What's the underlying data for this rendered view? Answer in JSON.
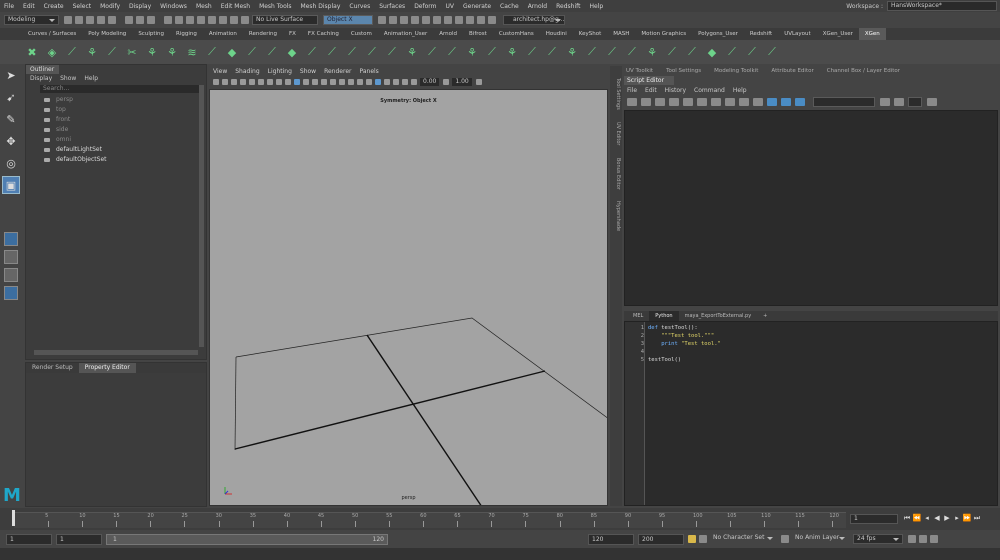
{
  "menubar": [
    "File",
    "Edit",
    "Create",
    "Select",
    "Modify",
    "Display",
    "Windows",
    "Mesh",
    "Edit Mesh",
    "Mesh Tools",
    "Mesh Display",
    "Curves",
    "Surfaces",
    "Deform",
    "UV",
    "Generate",
    "Cache",
    "Arnold",
    "Redshift",
    "Help"
  ],
  "workspace": {
    "label": "Workspace :",
    "value": "HansWorkspace*"
  },
  "statusline": {
    "mode": "Modeling",
    "live_surface": "No Live Surface",
    "symmetry": "Object X",
    "user": "architect.hp@g..."
  },
  "shelf_tabs": [
    "Curves / Surfaces",
    "Poly Modeling",
    "Sculpting",
    "Rigging",
    "Animation",
    "Rendering",
    "FX",
    "FX Caching",
    "Custom",
    "Animation_User",
    "Arnold",
    "Bifrost",
    "CustomHans",
    "Houdini",
    "KeyShot",
    "MASH",
    "Motion Graphics",
    "Polygons_User",
    "Redshift",
    "UVLayout",
    "XGen_User",
    "XGen"
  ],
  "shelf_active": "XGen",
  "outliner": {
    "title": "Outliner",
    "menu": [
      "Display",
      "Show",
      "Help"
    ],
    "search_placeholder": "Search...",
    "items": [
      {
        "label": "persp",
        "dim": true
      },
      {
        "label": "top",
        "dim": true
      },
      {
        "label": "front",
        "dim": true
      },
      {
        "label": "side",
        "dim": true
      },
      {
        "label": "omni",
        "dim": true
      },
      {
        "label": "defaultLightSet",
        "dim": false
      },
      {
        "label": "defaultObjectSet",
        "dim": false
      }
    ]
  },
  "lower_tabs": [
    "Render Setup",
    "Property Editor"
  ],
  "viewport": {
    "menu": [
      "View",
      "Shading",
      "Lighting",
      "Show",
      "Renderer",
      "Panels"
    ],
    "field1": "0.00",
    "field2": "1.00",
    "symmetry_label": "Symmetry: Object X",
    "camera": "persp"
  },
  "side_tabs": [
    "Tool Settings",
    "UV Editor",
    "Bonus Editor",
    "Hypershade"
  ],
  "right_tabs": [
    "UV Toolkit",
    "Tool Settings",
    "Modeling Toolkit",
    "Attribute Editor",
    "Channel Box / Layer Editor"
  ],
  "script_editor": {
    "title": "Script Editor",
    "menu": [
      "File",
      "Edit",
      "History",
      "Command",
      "Help"
    ],
    "tabs": [
      "MEL",
      "Python",
      "maya_ExportToExternal.py",
      "+"
    ],
    "active_tab": "Python",
    "lines": [
      {
        "n": "1",
        "code": "def testTool():"
      },
      {
        "n": "2",
        "code": "    \"\"\"Test tool.\"\"\""
      },
      {
        "n": "3",
        "code": "    print \"Test tool.\""
      },
      {
        "n": "4",
        "code": ""
      },
      {
        "n": "5",
        "code": "testTool()"
      }
    ]
  },
  "timeline": {
    "ticks": [
      "5",
      "10",
      "15",
      "20",
      "25",
      "30",
      "35",
      "40",
      "45",
      "50",
      "55",
      "60",
      "65",
      "70",
      "75",
      "80",
      "85",
      "90",
      "95",
      "100",
      "105",
      "110",
      "115",
      "120"
    ],
    "current_frame": "1"
  },
  "range": {
    "start": "1",
    "playback_start": "1",
    "slider_start": "1",
    "slider_end": "120",
    "playback_end": "120",
    "end": "200",
    "character_set": "No Character Set",
    "anim_layer": "No Anim Layer",
    "fps": "24 fps"
  }
}
